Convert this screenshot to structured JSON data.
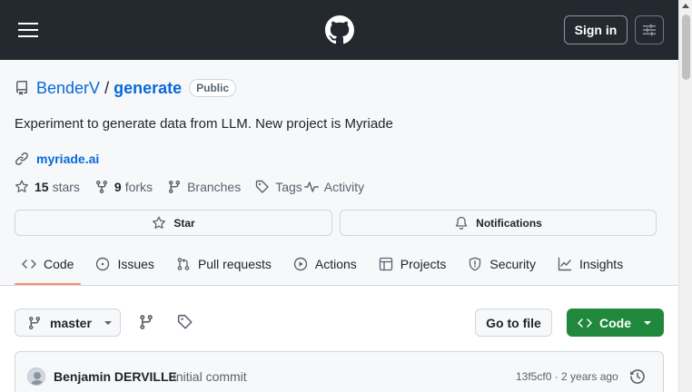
{
  "header": {
    "sign_in_label": "Sign in"
  },
  "repo": {
    "owner": "BenderV",
    "separator": "/",
    "name": "generate",
    "visibility": "Public",
    "description": "Experiment to generate data from LLM. New project is Myriade",
    "website": "myriade.ai",
    "stars_count": "15",
    "stars_label": "stars",
    "forks_count": "9",
    "forks_label": "forks",
    "branches_label": "Branches",
    "tags_label": "Tags",
    "activity_label": "Activity",
    "star_button": "Star",
    "notifications_button": "Notifications"
  },
  "tabs": [
    {
      "label": "Code",
      "icon": "code-icon",
      "active": true
    },
    {
      "label": "Issues",
      "icon": "issue-icon"
    },
    {
      "label": "Pull requests",
      "icon": "pull-request-icon"
    },
    {
      "label": "Actions",
      "icon": "play-icon"
    },
    {
      "label": "Projects",
      "icon": "table-icon"
    },
    {
      "label": "Security",
      "icon": "shield-icon"
    },
    {
      "label": "Insights",
      "icon": "graph-icon"
    }
  ],
  "main": {
    "branch": "master",
    "go_to_file": "Go to file",
    "code_button": "Code",
    "commit": {
      "author": "Benjamin DERVILLE",
      "message": "Initial commit",
      "meta": "13f5cf0 · 2 years ago"
    }
  },
  "colors": {
    "header_bg": "#24292f",
    "link": "#0969da",
    "code_button": "#1f883d",
    "active_tab_underline": "#fd8c73"
  }
}
